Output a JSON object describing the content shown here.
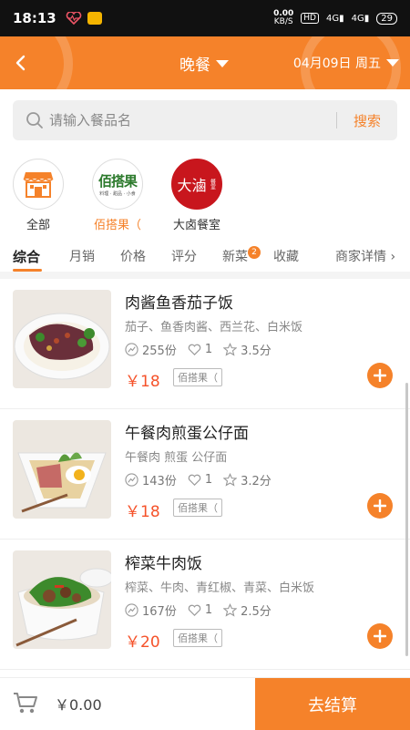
{
  "status_bar": {
    "time": "18:13",
    "net_speed_value": "0.00",
    "net_speed_unit": "KB/S",
    "hd_label": "HD",
    "signal1": "4G",
    "signal2": "4G",
    "battery": "29"
  },
  "header": {
    "meal": "晚餐",
    "date": "04月09日 周五"
  },
  "search": {
    "placeholder": "请输入餐品名",
    "button": "搜索"
  },
  "shops": [
    {
      "name": "全部"
    },
    {
      "name": "佰搭果（",
      "logo_text": "佰搭果",
      "logo_sub": "料理 · 甜品 · 小食"
    },
    {
      "name": "大卤餐室",
      "logo_text": "大滷",
      "logo_side": "餐室"
    }
  ],
  "tabs": {
    "t0": "综合",
    "t1": "月销",
    "t2": "价格",
    "t3": "评分",
    "t4": "新菜",
    "t4_badge": "2",
    "t5": "收藏",
    "t6": "商家详情"
  },
  "items": [
    {
      "title": "肉酱鱼香茄子饭",
      "desc": "茄子、鱼香肉酱、西兰花、白米饭",
      "sales": "255份",
      "likes": "1",
      "rating": "3.5分",
      "price": "￥18",
      "shop_tag": "佰搭果（"
    },
    {
      "title": "午餐肉煎蛋公仔面",
      "desc": "午餐肉 煎蛋 公仔面",
      "sales": "143份",
      "likes": "1",
      "rating": "3.2分",
      "price": "￥18",
      "shop_tag": "佰搭果（"
    },
    {
      "title": "榨菜牛肉饭",
      "desc": "榨菜、牛肉、青红椒、青菜、白米饭",
      "sales": "167份",
      "likes": "1",
      "rating": "2.5分",
      "price": "￥20",
      "shop_tag": "佰搭果（"
    }
  ],
  "cart": {
    "total": "￥0.00",
    "checkout": "去结算"
  },
  "colors": {
    "accent": "#f5822a",
    "price": "#f5522a"
  }
}
